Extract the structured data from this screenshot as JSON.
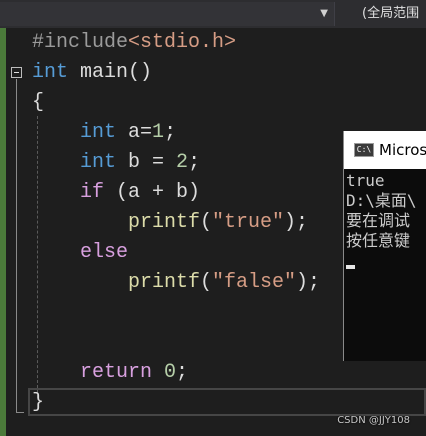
{
  "toolbar": {
    "scope_label": "(全局范围"
  },
  "code": {
    "lines": [
      {
        "include": "#include",
        "header": "<stdio.h>"
      },
      {
        "type": "int",
        "name": "main",
        "parens": "()"
      },
      {
        "text": "{"
      },
      {
        "type": "int",
        "decl": "a=",
        "value": "1",
        "end": ";"
      },
      {
        "type": "int",
        "decl": "b = ",
        "value": "2",
        "end": ";"
      },
      {
        "kw": "if",
        "cond": "(a + b)"
      },
      {
        "fn": "printf",
        "open": "(",
        "str": "\"true\"",
        "close": ");"
      },
      {
        "kw": "else"
      },
      {
        "fn": "printf",
        "open": "(",
        "str": "\"false\"",
        "close": ");"
      },
      {
        "kw": "return",
        "space": " ",
        "value": "0",
        "end": ";"
      },
      {
        "text": "}"
      }
    ]
  },
  "console": {
    "title": "Micros",
    "output": [
      "true",
      "D:\\桌面\\",
      "要在调试",
      "按任意键"
    ]
  },
  "watermark": "CSDN @JJY108",
  "colors": {
    "keyword": "#569cd6",
    "control": "#d8a0df",
    "string": "#d69d85",
    "number": "#b5cea8",
    "function": "#dcdcaa",
    "background": "#1e1e1e",
    "change_bar": "#4b7a3a"
  },
  "icons": {
    "collapse": "collapse-minus-icon",
    "console": "console-app-icon",
    "dropdown": "chevron-down-icon"
  }
}
